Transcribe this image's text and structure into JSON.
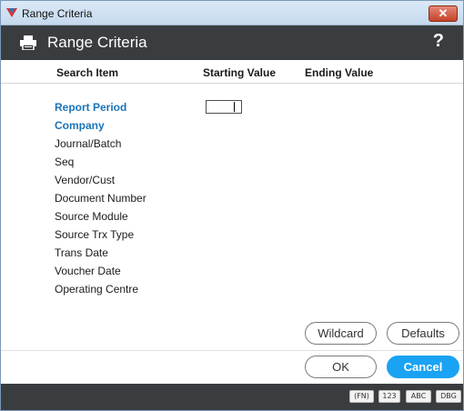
{
  "window": {
    "title": "Range Criteria",
    "close_label": "✕"
  },
  "header": {
    "title": "Range Criteria",
    "help_label": "?"
  },
  "columns": {
    "search_item": "Search Item",
    "starting_value": "Starting Value",
    "ending_value": "Ending Value"
  },
  "items": [
    {
      "label": "Report Period",
      "active": true
    },
    {
      "label": "Company",
      "active": true
    },
    {
      "label": "Journal/Batch",
      "active": false
    },
    {
      "label": "Seq",
      "active": false
    },
    {
      "label": "Vendor/Cust",
      "active": false
    },
    {
      "label": "Document Number",
      "active": false
    },
    {
      "label": "Source Module",
      "active": false
    },
    {
      "label": "Source Trx Type",
      "active": false
    },
    {
      "label": "Trans Date",
      "active": false
    },
    {
      "label": "Voucher Date",
      "active": false
    },
    {
      "label": "Operating Centre",
      "active": false
    }
  ],
  "starting_value": {
    "report_period": ""
  },
  "buttons": {
    "wildcard": "Wildcard",
    "defaults": "Defaults",
    "ok": "OK",
    "cancel": "Cancel"
  },
  "status_badges": [
    "(FN)",
    "123",
    "ABC",
    "DBG"
  ],
  "colors": {
    "header_bg": "#3a3d40",
    "accent_blue": "#1aa3f2",
    "active_item": "#1a74b8"
  }
}
